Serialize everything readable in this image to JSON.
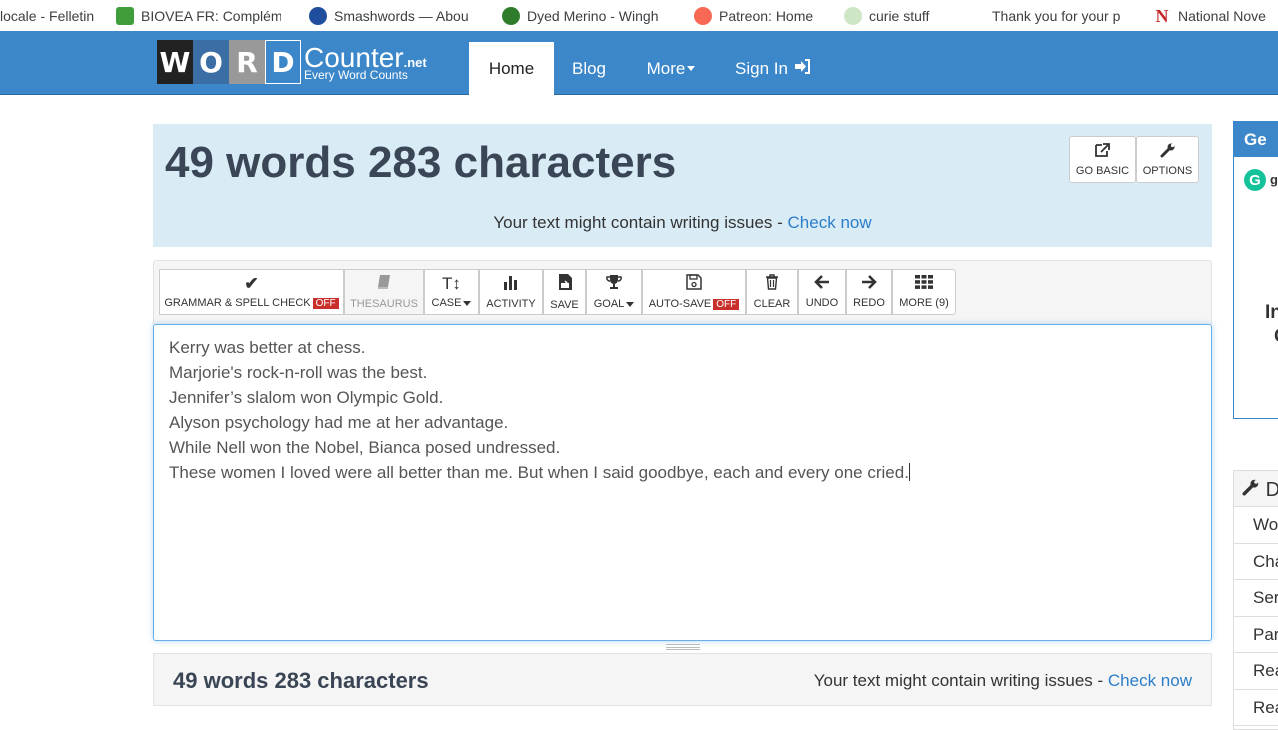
{
  "bookmarks": [
    {
      "label": "locale - Felletin",
      "color": "#ffffff"
    },
    {
      "label": "BIOVEA FR: Complém",
      "color": "#3f9e3a"
    },
    {
      "label": "Smashwords — Abou",
      "color": "#1f4e9c"
    },
    {
      "label": "Dyed Merino - Wingh",
      "color": "#2f7d2c"
    },
    {
      "label": "Patreon: Home",
      "color": "#f96854"
    },
    {
      "label": "curie stuff",
      "color": "#cfe6c4"
    },
    {
      "label": "Thank you for your p",
      "color": "#ffffff"
    },
    {
      "label": "National Nove",
      "color": "#c62828"
    }
  ],
  "navbar": {
    "logo_letters": [
      "W",
      "O",
      "R",
      "D"
    ],
    "logo_colors": [
      "#222222",
      "#3a6ea5",
      "#999999",
      "#3b87c9"
    ],
    "logo_counter": "Counter",
    "logo_net": ".net",
    "logo_tagline": "Every Word Counts",
    "items": [
      {
        "label": "Home",
        "active": true
      },
      {
        "label": "Blog",
        "active": false
      },
      {
        "label": "More",
        "active": false
      },
      {
        "label": "Sign In",
        "active": false
      }
    ]
  },
  "stats": {
    "count_text": "49 words 283 characters",
    "issues_text": "Your text might contain writing issues - ",
    "check_link": "Check now"
  },
  "top_buttons": {
    "go_basic": "GO BASIC",
    "options": "OPTIONS"
  },
  "toolbar": {
    "grammar": "GRAMMAR & SPELL CHECK",
    "grammar_state": "OFF",
    "thesaurus": "THESAURUS",
    "case": "CASE",
    "activity": "ACTIVITY",
    "save": "SAVE",
    "goal": "GOAL",
    "autosave": "AUTO-SAVE",
    "autosave_state": "OFF",
    "clear": "CLEAR",
    "undo": "UNDO",
    "redo": "REDO",
    "more": "MORE (9)"
  },
  "editor": {
    "lines": [
      "Kerry was better at chess.",
      "Marjorie's rock-n-roll was the best.",
      "Jennifer’s slalom won Olympic Gold.",
      "Alyson psychology had me at her advantage.",
      "While Nell won the Nobel, Bianca posed undressed.",
      "These women I loved were all better than me. But when I said goodbye, each and every one cried."
    ]
  },
  "sidebar_ad": {
    "header": "Ge",
    "logo_letter": "G",
    "logo_text": "g",
    "line1": "In",
    "line2": "C"
  },
  "sidebar_panel": {
    "header": "D",
    "items": [
      "Wo",
      "Cha",
      "Ser",
      "Par",
      "Rea",
      "Rea"
    ]
  }
}
